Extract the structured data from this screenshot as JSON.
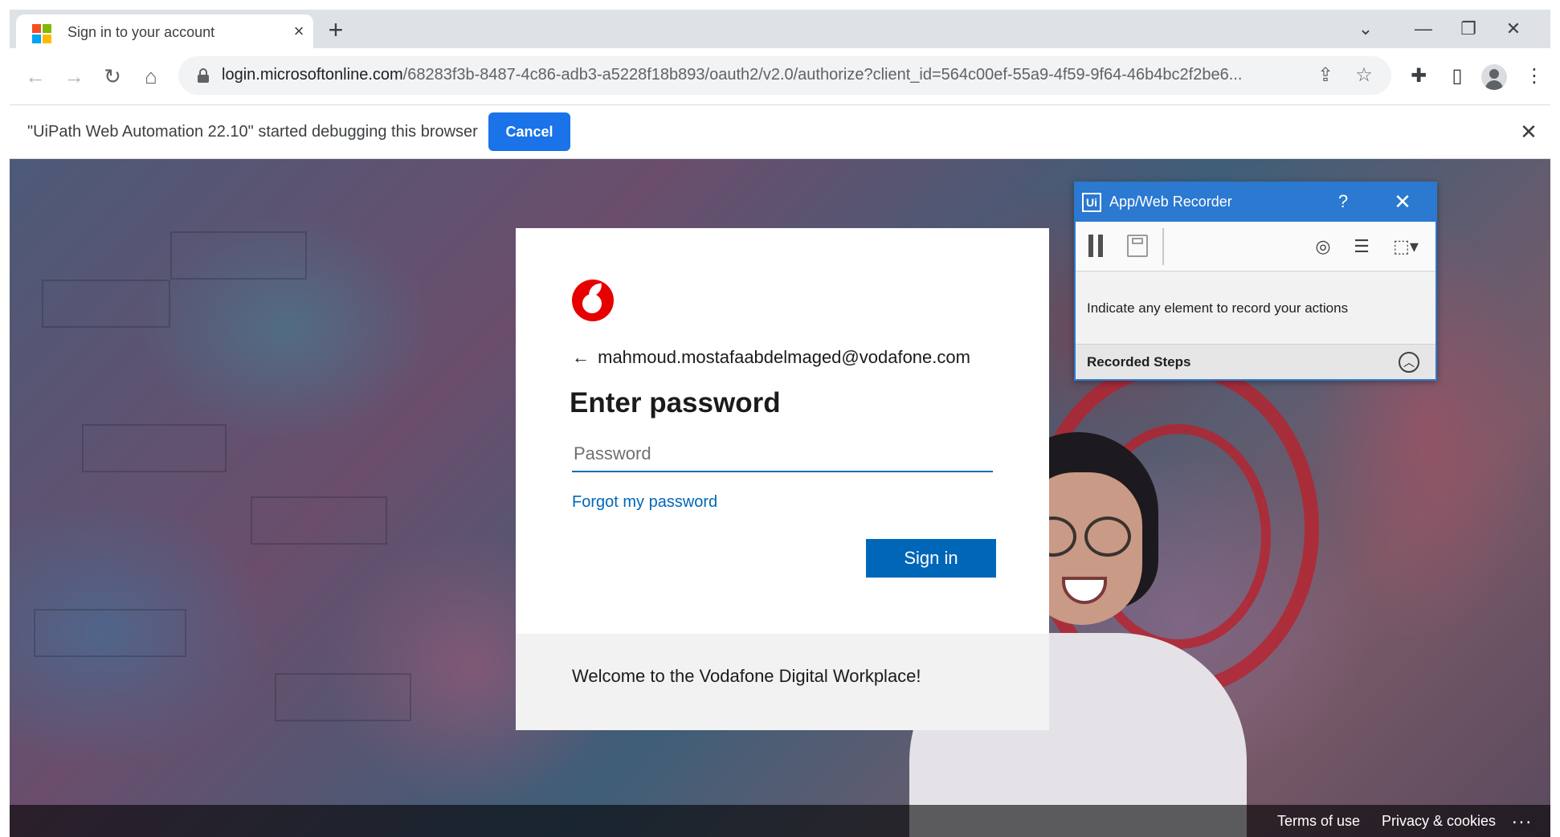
{
  "browser": {
    "tab": {
      "title": "Sign in to your account",
      "close_icon": "×"
    },
    "new_tab_icon": "+",
    "window_controls": {
      "search_tabs_icon": "⌄",
      "minimize_icon": "—",
      "restore_icon": "❐",
      "close_icon": "✕"
    },
    "nav": {
      "back_icon": "←",
      "forward_icon": "→",
      "reload_icon": "↻",
      "home_icon": "⌂"
    },
    "address": {
      "host": "login.microsoftonline.com",
      "path": "/68283f3b-8487-4c86-adb3-a5228f18b893/oauth2/v2.0/authorize?client_id=564c00ef-55a9-4f59-9f64-46b4bc2f2be6..."
    },
    "toolbar_icons": {
      "share": "⇪",
      "bookmark": "☆",
      "extensions": "✚",
      "side_panel": "▯",
      "menu": "⋮"
    }
  },
  "infobar": {
    "message": "\"UiPath Web Automation 22.10\" started debugging this browser",
    "cancel_label": "Cancel",
    "close_icon": "✕"
  },
  "login": {
    "identity_back_icon": "←",
    "email": "mahmoud.mostafaabdelmaged@vodafone.com",
    "title": "Enter password",
    "password_placeholder": "Password",
    "password_value": "",
    "forgot_label": "Forgot my password",
    "signin_label": "Sign in",
    "welcome_text": "Welcome to the Vodafone Digital Workplace!"
  },
  "footer": {
    "terms": "Terms of use",
    "privacy": "Privacy & cookies",
    "more": "..."
  },
  "recorder": {
    "logo_text": "Ui",
    "title": "App/Web Recorder",
    "help_icon": "?",
    "close_icon": "✕",
    "tools": {
      "target_icon": "◎",
      "checklist_icon": "☰",
      "select_icon": "⬚▾"
    },
    "hint": "Indicate any element to record your actions",
    "steps_label": "Recorded Steps",
    "collapse_icon": "︿"
  },
  "colors": {
    "accent_chrome": "#1a73e8",
    "ms_blue": "#0067b8",
    "vodafone_red": "#e60000",
    "uipath_blue": "#2b79d0"
  }
}
